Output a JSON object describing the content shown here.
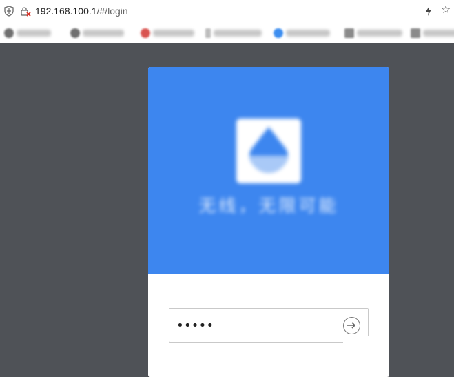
{
  "browser": {
    "url_host": "192.168.100.1",
    "url_path": "/#/login",
    "security_icon": "shield-icon",
    "insecure_icon": "insecure-lock-icon",
    "action_icons": [
      "lightning-icon",
      "bookmark-star-icon"
    ],
    "star_glyph": "☆"
  },
  "bookmarks": [
    {
      "icon_color": "#707070"
    },
    {
      "icon_color": "#707070"
    },
    {
      "icon_color": "#d9534f"
    },
    {
      "icon_color": "#bdbdbd"
    },
    {
      "icon_color": "#3d8ef0"
    },
    {
      "icon_color": "#8a8a8a"
    },
    {
      "icon_color": "#8a8a8a"
    }
  ],
  "login": {
    "header_color": "#3d86ef",
    "slogan": "无线，无限可能",
    "password_value": "•••••",
    "submit_icon": "arrow-right-circle-icon"
  }
}
